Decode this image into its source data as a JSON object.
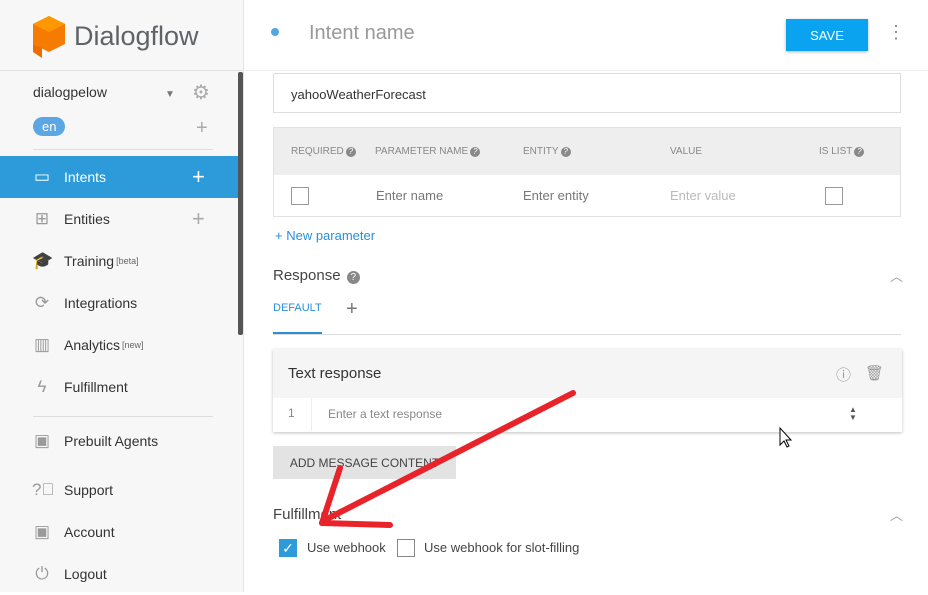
{
  "app": {
    "brand": "Dialogflow"
  },
  "sidebar": {
    "agent": "dialogpelow",
    "language": "en",
    "items": [
      {
        "label": "Intents"
      },
      {
        "label": "Entities"
      },
      {
        "label": "Training",
        "badge": "[beta]"
      },
      {
        "label": "Integrations"
      },
      {
        "label": "Analytics",
        "badge": "[new]"
      },
      {
        "label": "Fulfillment"
      },
      {
        "label": "Prebuilt Agents"
      },
      {
        "label": "Support"
      },
      {
        "label": "Account"
      },
      {
        "label": "Logout"
      }
    ]
  },
  "header": {
    "intent_name_placeholder": "Intent name",
    "save": "SAVE"
  },
  "action": {
    "value": "yahooWeatherForecast"
  },
  "params": {
    "headers": [
      "REQUIRED",
      "PARAMETER NAME",
      "ENTITY",
      "VALUE",
      "IS LIST"
    ],
    "name_ph": "Enter name",
    "entity_ph": "Enter entity",
    "value_ph": "Enter value",
    "new": "+ New parameter"
  },
  "response": {
    "title": "Response",
    "tab": "DEFAULT",
    "card_title": "Text response",
    "row_num": "1",
    "row_ph": "Enter a text response",
    "add": "ADD MESSAGE CONTENT"
  },
  "fulfillment": {
    "title": "Fulfillment",
    "webhook": "Use webhook",
    "webhook_checked": true,
    "slot": "Use webhook for slot-filling",
    "slot_checked": false
  }
}
